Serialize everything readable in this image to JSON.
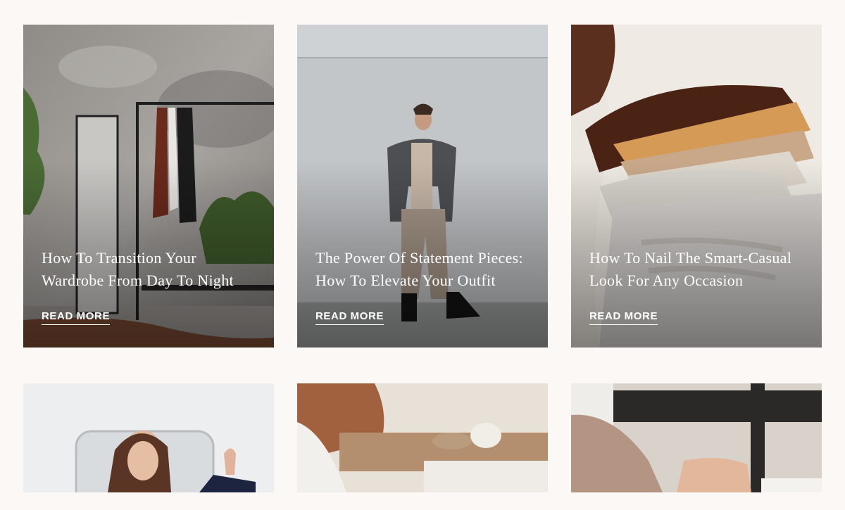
{
  "posts": [
    {
      "title": "How To Transition Your Wardrobe From Day To Night",
      "cta": "READ MORE"
    },
    {
      "title": "The Power Of Statement Pieces: How To Elevate Your Outfit",
      "cta": "READ MORE"
    },
    {
      "title": "How To Nail The Smart-Casual Look For Any Occasion",
      "cta": "READ MORE"
    }
  ],
  "colors": {
    "page_bg": "#fcf8f5",
    "text_overlay": "#ffffff"
  }
}
